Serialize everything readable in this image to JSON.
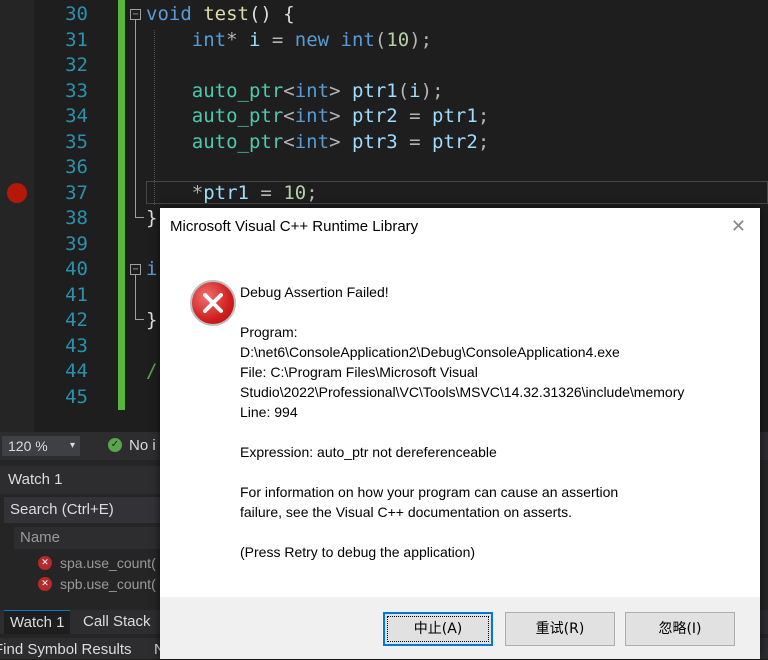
{
  "editor": {
    "lines": [
      {
        "num": "30"
      },
      {
        "num": "31"
      },
      {
        "num": "32"
      },
      {
        "num": "33"
      },
      {
        "num": "34"
      },
      {
        "num": "35"
      },
      {
        "num": "36"
      },
      {
        "num": "37"
      },
      {
        "num": "38"
      },
      {
        "num": "39"
      },
      {
        "num": "40"
      },
      {
        "num": "41"
      },
      {
        "num": "42"
      },
      {
        "num": "43"
      },
      {
        "num": "44"
      },
      {
        "num": "45"
      }
    ],
    "code": {
      "l30_kw": "void",
      "l30_fn": "test",
      "l30_rest": "() {",
      "l31_kw1": "int",
      "l31_op1": "* ",
      "l31_var": "i",
      "l31_op2": " = ",
      "l31_kw2": "new",
      "l31_kw3": "int",
      "l31_op3": "(",
      "l31_num": "10",
      "l31_op4": ");",
      "l33_ty": "auto_ptr",
      "l33_op1": "<",
      "l33_kw": "int",
      "l33_op2": "> ",
      "l33_var": "ptr1",
      "l33_op3": "(",
      "l33_var2": "i",
      "l33_op4": ");",
      "l34_ty": "auto_ptr",
      "l34_op1": "<",
      "l34_kw": "int",
      "l34_op2": "> ",
      "l34_var": "ptr2",
      "l34_op3": " = ",
      "l34_var2": "ptr1",
      "l34_op4": ";",
      "l35_ty": "auto_ptr",
      "l35_op1": "<",
      "l35_kw": "int",
      "l35_op2": "> ",
      "l35_var": "ptr3",
      "l35_op3": " = ",
      "l35_var2": "ptr2",
      "l35_op4": ";",
      "l37_op1": "*",
      "l37_var": "ptr1",
      "l37_op2": " = ",
      "l37_num": "10",
      "l37_op3": ";",
      "l38": "}",
      "l40": "i",
      "l42": "}",
      "l44": "/"
    }
  },
  "status": {
    "zoom": "120 %",
    "zoom_caret": "▾",
    "issues_text": "No i",
    "issues_check": "✓"
  },
  "watch": {
    "title": "Watch 1",
    "search_label": "Search (Ctrl+E)",
    "col_name": "Name",
    "rows": [
      {
        "name": "spa.use_count("
      },
      {
        "name": "spb.use_count("
      }
    ],
    "err_mark": "✕"
  },
  "bottom": {
    "tab_watch": "Watch 1",
    "tab_callstack": "Call Stack",
    "find_symbol": "Find Symbol Results",
    "partial": "N"
  },
  "dialog": {
    "title": "Microsoft Visual C++ Runtime Library",
    "close": "✕",
    "heading": "Debug Assertion Failed!",
    "program_label": "Program:",
    "program_path": "D:\\net6\\ConsoleApplication2\\Debug\\ConsoleApplication4.exe",
    "file_line1": "File: C:\\Program Files\\Microsoft Visual",
    "file_line2": "Studio\\2022\\Professional\\VC\\Tools\\MSVC\\14.32.31326\\include\\memory",
    "line_info": "Line: 994",
    "expression": "Expression: auto_ptr not dereferenceable",
    "info_line1": "For information on how your program can cause an assertion",
    "info_line2": "failure, see the Visual C++ documentation on asserts.",
    "retry_hint": "(Press Retry to debug the application)",
    "buttons": {
      "abort": "中止(A)",
      "retry": "重试(R)",
      "ignore": "忽略(I)"
    }
  }
}
